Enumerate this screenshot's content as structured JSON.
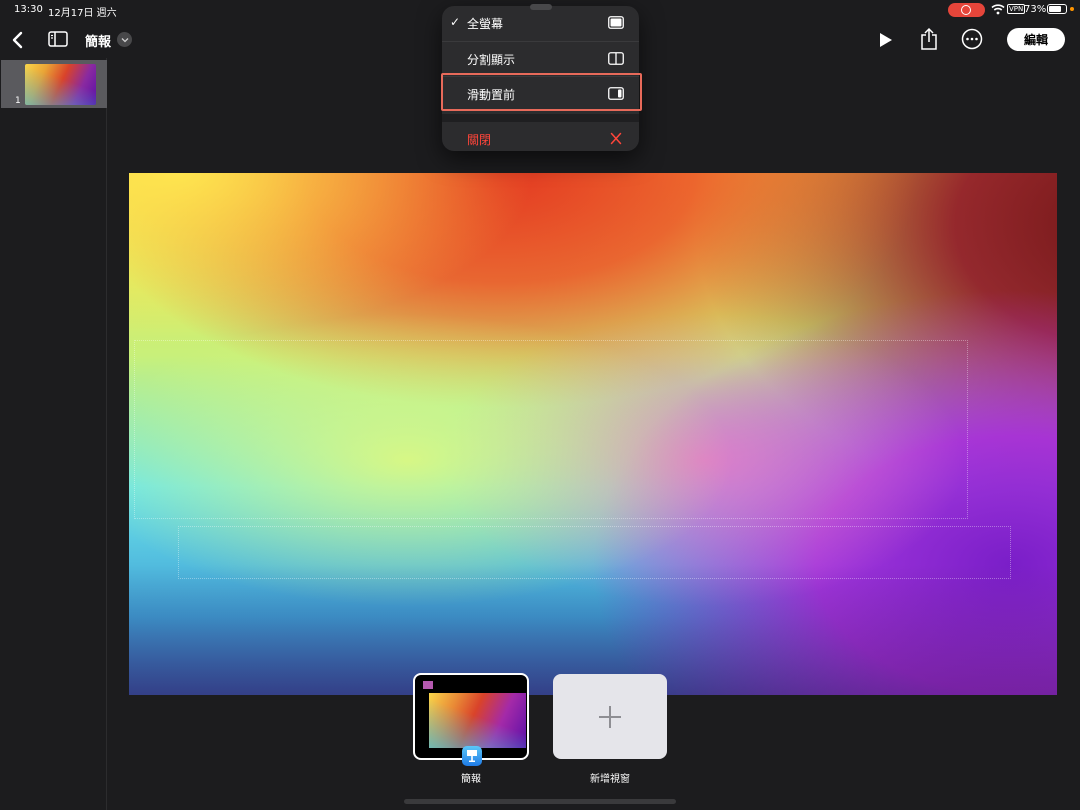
{
  "status_bar": {
    "time": "13:30",
    "date": "12月17日 週六",
    "vpn": "VPN",
    "battery": "73%",
    "record_color": "#e5453a"
  },
  "toolbar": {
    "title": "簡報",
    "edit_label": "編輯"
  },
  "navigator": {
    "slides": [
      {
        "number": "1"
      }
    ]
  },
  "menu": {
    "items": [
      {
        "label": "全螢幕",
        "checked": true,
        "icon": "full-screen-icon"
      },
      {
        "label": "分割顯示",
        "checked": false,
        "icon": "split-view-icon"
      },
      {
        "label": "滑動置前",
        "checked": false,
        "icon": "slide-over-icon",
        "highlighted": true
      },
      {
        "label": "關閉",
        "checked": false,
        "icon": "close-icon",
        "destructive": true
      }
    ],
    "check_mark": "✓",
    "highlight_color": "#e86a5a",
    "destructive_color": "#ff453a"
  },
  "shelf": {
    "windows": [
      {
        "label": "簡報"
      }
    ],
    "new_window_label": "新增視窗"
  }
}
